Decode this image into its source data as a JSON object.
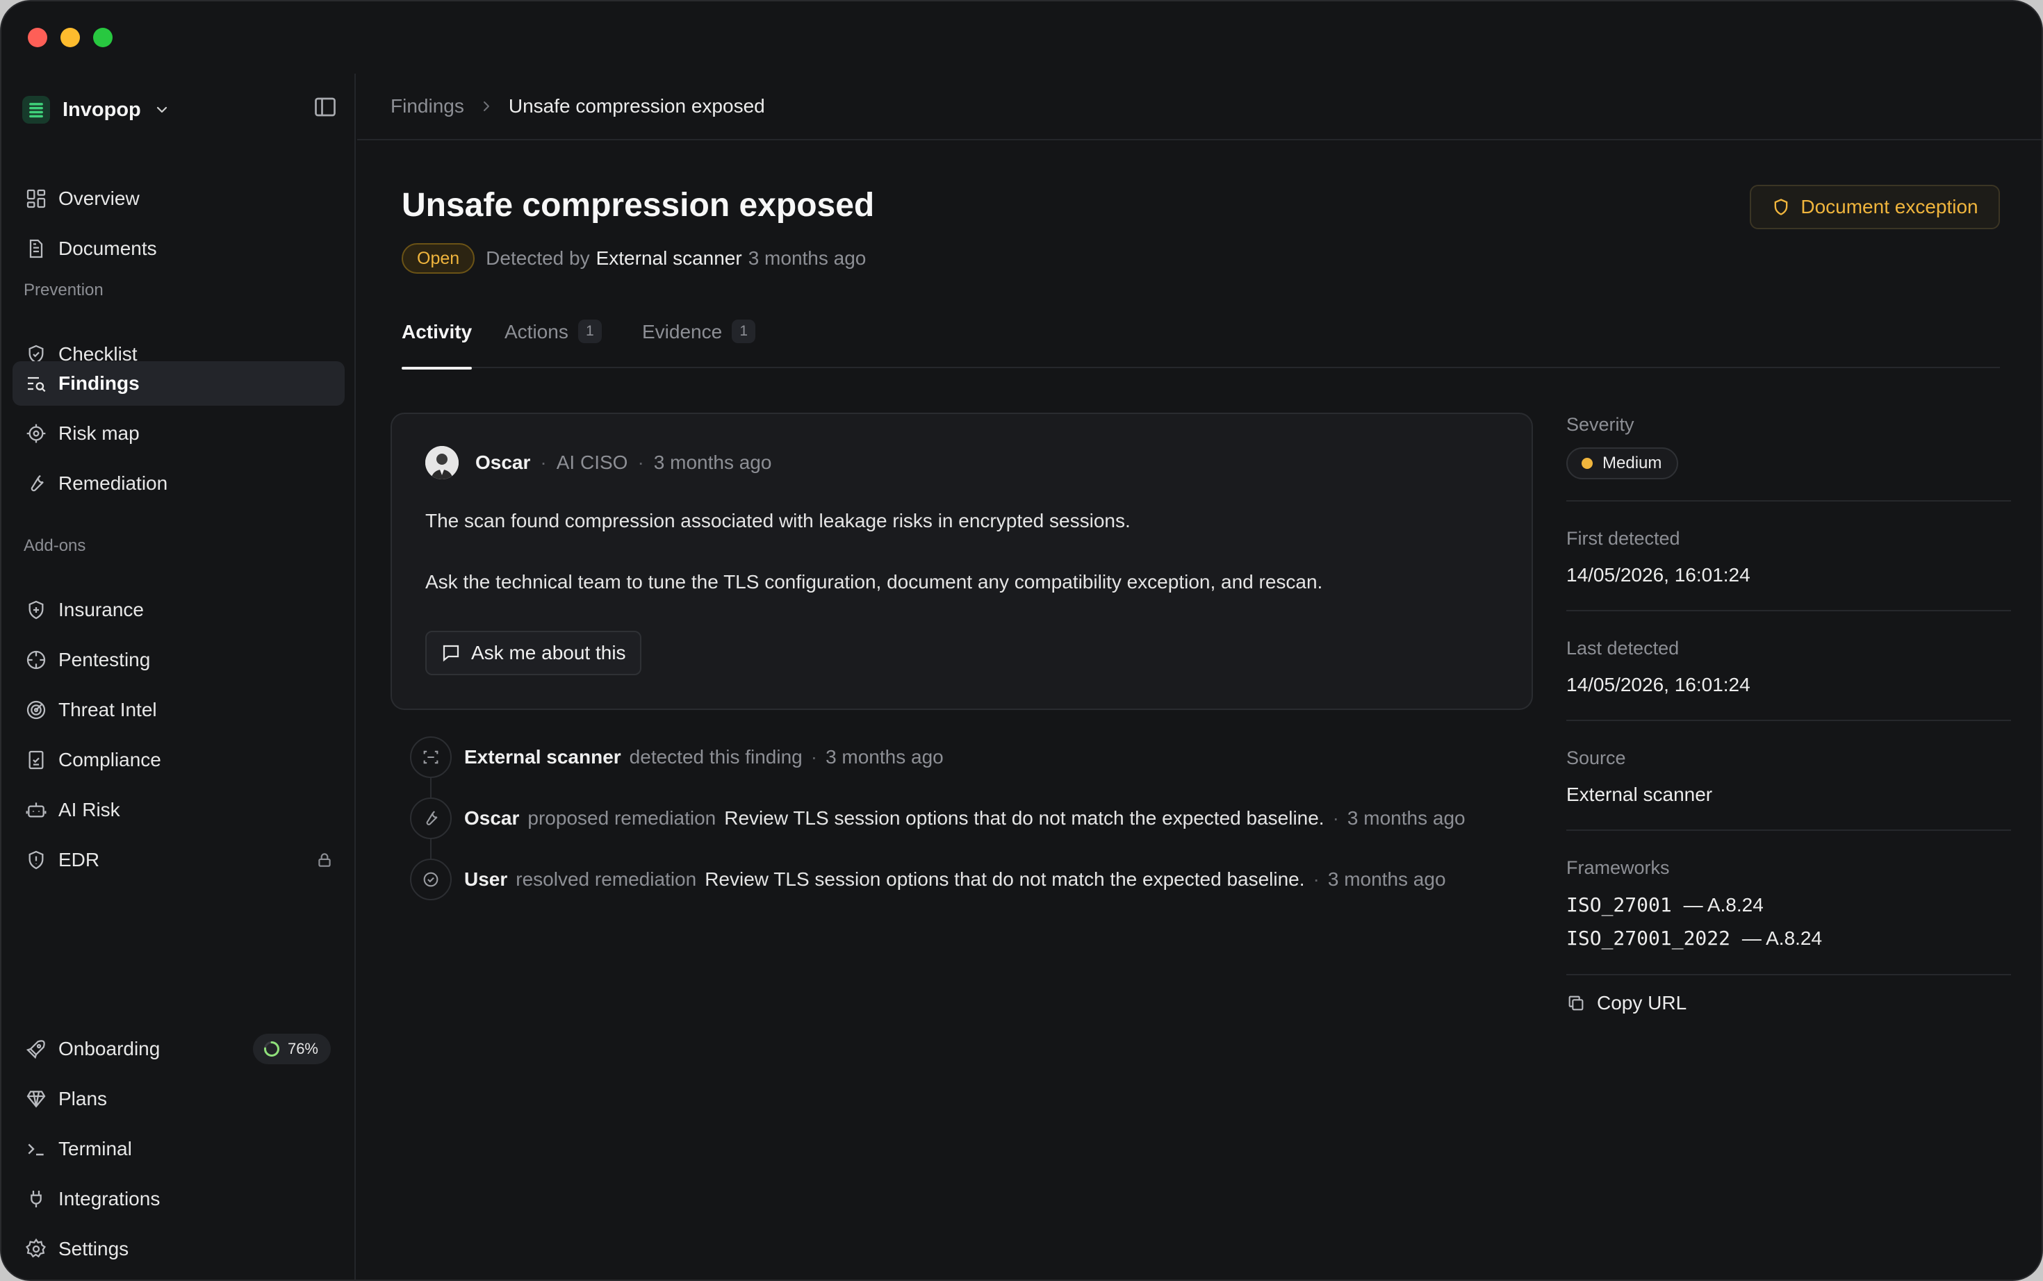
{
  "workspace": {
    "name": "Invopop"
  },
  "sidebar": {
    "top_items": [
      {
        "label": "Overview",
        "icon": "grid-icon"
      },
      {
        "label": "Documents",
        "icon": "document-icon"
      }
    ],
    "prevention_label": "Prevention",
    "prevention_items": [
      {
        "label": "Checklist",
        "icon": "shield-check-icon"
      },
      {
        "label": "Findings",
        "icon": "search-list-icon",
        "active": true
      },
      {
        "label": "Risk map",
        "icon": "target-icon"
      },
      {
        "label": "Remediation",
        "icon": "wrench-icon"
      }
    ],
    "addons_label": "Add-ons",
    "addon_items": [
      {
        "label": "Insurance",
        "icon": "shield-plus-icon"
      },
      {
        "label": "Pentesting",
        "icon": "crosshair-icon"
      },
      {
        "label": "Threat Intel",
        "icon": "radar-icon"
      },
      {
        "label": "Compliance",
        "icon": "clipboard-check-icon"
      },
      {
        "label": "AI Risk",
        "icon": "robot-icon"
      },
      {
        "label": "EDR",
        "icon": "shield-alert-icon",
        "locked": true
      }
    ],
    "bottom_items": [
      {
        "label": "Onboarding",
        "icon": "rocket-icon",
        "progress": "76%",
        "progress_value": 76
      },
      {
        "label": "Plans",
        "icon": "gem-icon"
      },
      {
        "label": "Terminal",
        "icon": "terminal-icon"
      },
      {
        "label": "Integrations",
        "icon": "plug-icon"
      },
      {
        "label": "Settings",
        "icon": "gear-icon"
      }
    ]
  },
  "breadcrumb": {
    "parent": "Findings",
    "current": "Unsafe compression exposed"
  },
  "finding": {
    "title": "Unsafe compression exposed",
    "status": "Open",
    "detected_by_prefix": "Detected by",
    "detected_by": "External scanner",
    "detected_ago": "3 months ago",
    "action_button": "Document exception"
  },
  "tabs": [
    {
      "label": "Activity",
      "active": true
    },
    {
      "label": "Actions",
      "count": "1"
    },
    {
      "label": "Evidence",
      "count": "1"
    }
  ],
  "comment": {
    "author": "Oscar",
    "role": "AI CISO",
    "time": "3 months ago",
    "paragraph1": "The scan found compression associated with leakage risks in encrypted sessions.",
    "paragraph2": "Ask the technical team to tune the TLS configuration, document any compatibility exception, and rescan.",
    "ask_button": "Ask me about this"
  },
  "timeline": [
    {
      "actor": "External scanner",
      "action": "detected this finding",
      "detail": "",
      "time": "3 months ago",
      "icon": "scan-icon"
    },
    {
      "actor": "Oscar",
      "action": "proposed remediation",
      "detail": "Review TLS session options that do not match the expected baseline.",
      "time": "3 months ago",
      "icon": "wrench-icon"
    },
    {
      "actor": "User",
      "action": "resolved remediation",
      "detail": "Review TLS session options that do not match the expected baseline.",
      "time": "3 months ago",
      "icon": "check-circle-icon"
    }
  ],
  "details": {
    "severity_label": "Severity",
    "severity": "Medium",
    "first_detected_label": "First detected",
    "first_detected": "14/05/2026, 16:01:24",
    "last_detected_label": "Last detected",
    "last_detected": "14/05/2026, 16:01:24",
    "source_label": "Source",
    "source": "External scanner",
    "frameworks_label": "Frameworks",
    "frameworks": [
      {
        "code": "ISO_27001",
        "control": "— A.8.24"
      },
      {
        "code": "ISO_27001_2022",
        "control": "— A.8.24"
      }
    ],
    "copy_url": "Copy URL"
  },
  "colors": {
    "accent_warning": "#f0b53d",
    "background": "#141517",
    "card": "#1a1b1e",
    "muted_text": "#8d8f95"
  }
}
